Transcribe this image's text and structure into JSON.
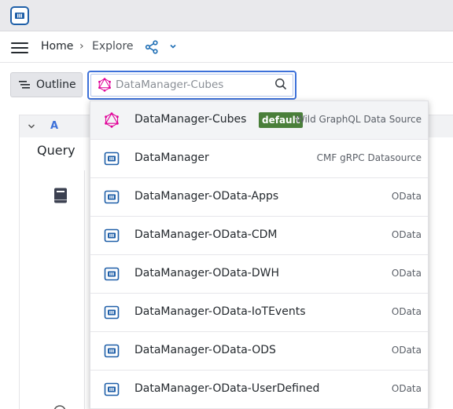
{
  "navbar": {
    "breadcrumb": {
      "home": "Home",
      "separator": "›",
      "current": "Explore"
    }
  },
  "toolbar": {
    "outline_label": "Outline"
  },
  "datasource_picker": {
    "placeholder": "DataManager-Cubes",
    "value": ""
  },
  "query_editor": {
    "query_letter": "A",
    "tab_label": "Query"
  },
  "datasources": [
    {
      "name": "DataManager-Cubes",
      "type": "Wild GraphQL Data Source",
      "badge": "default",
      "icon": "graphql-icon"
    },
    {
      "name": "DataManager",
      "type": "CMF gRPC Datasource",
      "icon": "cmf-icon"
    },
    {
      "name": "DataManager-OData-Apps",
      "type": "OData",
      "icon": "cmf-icon"
    },
    {
      "name": "DataManager-OData-CDM",
      "type": "OData",
      "icon": "cmf-icon"
    },
    {
      "name": "DataManager-OData-DWH",
      "type": "OData",
      "icon": "cmf-icon"
    },
    {
      "name": "DataManager-OData-IoTEvents",
      "type": "OData",
      "icon": "cmf-icon"
    },
    {
      "name": "DataManager-OData-ODS",
      "type": "OData",
      "icon": "cmf-icon"
    },
    {
      "name": "DataManager-OData-UserDefined",
      "type": "OData",
      "icon": "cmf-icon"
    }
  ],
  "colors": {
    "accent": "#3d71d9",
    "badge": "#4a7f3a",
    "graphql_pink": "#e10098",
    "cmf_blue": "#1f5fa8"
  }
}
